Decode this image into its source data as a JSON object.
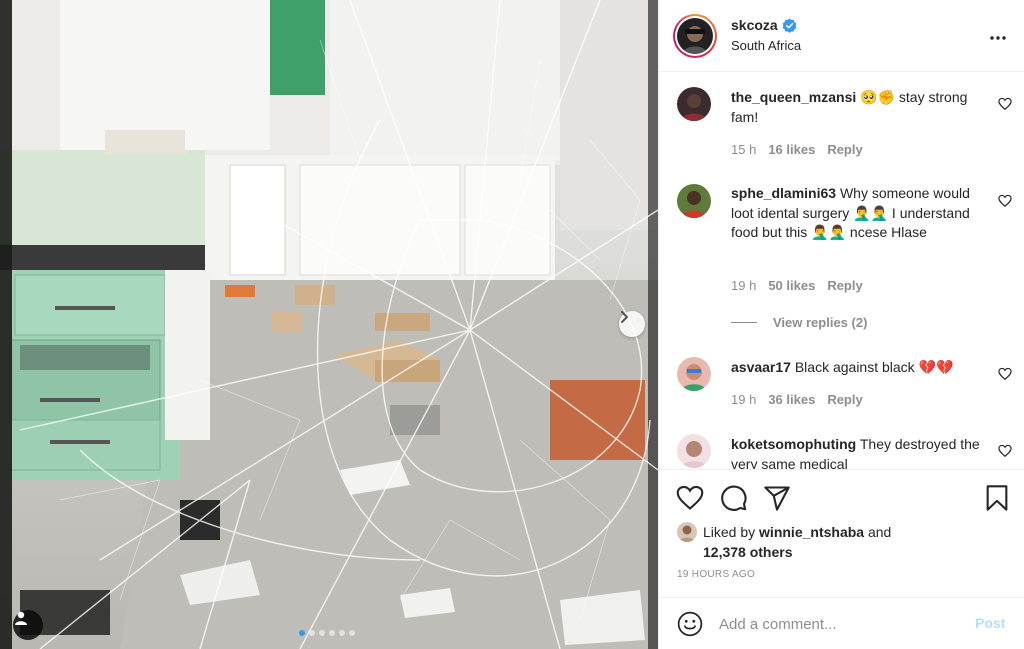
{
  "post": {
    "username": "skcoza",
    "location": "South Africa",
    "verified": true
  },
  "carousel": {
    "total": 6,
    "active_index": 0
  },
  "comments": [
    {
      "username": "the_queen_mzansi",
      "text": "🥺✊ stay strong fam!",
      "time": "15 h",
      "likes": "16 likes",
      "reply": "Reply"
    },
    {
      "username": "sphe_dlamini63",
      "text": "Why someone would loot idental surgery 🤦‍♂️🤦‍♂️ I understand food but this 🤦‍♂️🤦‍♂️ ncese Hlase",
      "time": "19 h",
      "likes": "50 likes",
      "reply": "Reply",
      "view_replies": "View replies (2)"
    },
    {
      "username": "asvaar17",
      "text": "Black against black 💔💔",
      "time": "19 h",
      "likes": "36 likes",
      "reply": "Reply"
    },
    {
      "username": "koketsomophuting",
      "text": "They destroyed the very same medical"
    }
  ],
  "likes": {
    "prefix": "Liked by",
    "user": "winnie_ntshaba",
    "and": "and",
    "others": "12,378 others"
  },
  "timeago": "19 HOURS AGO",
  "add_comment": {
    "placeholder": "Add a comment...",
    "post_label": "Post"
  },
  "icons": {
    "more": "more-options-icon",
    "heart": "heart-icon",
    "comment": "comment-icon",
    "share": "share-icon",
    "save": "bookmark-icon",
    "emoji": "emoji-icon",
    "verified": "verified-badge-icon",
    "next": "chevron-right-icon",
    "tag": "user-tag-icon"
  },
  "colors": {
    "link_blue": "#3897f0",
    "verified_blue": "#3897f0",
    "post_disabled": "#b2dffc",
    "meta_grey": "#8e8e8e"
  }
}
